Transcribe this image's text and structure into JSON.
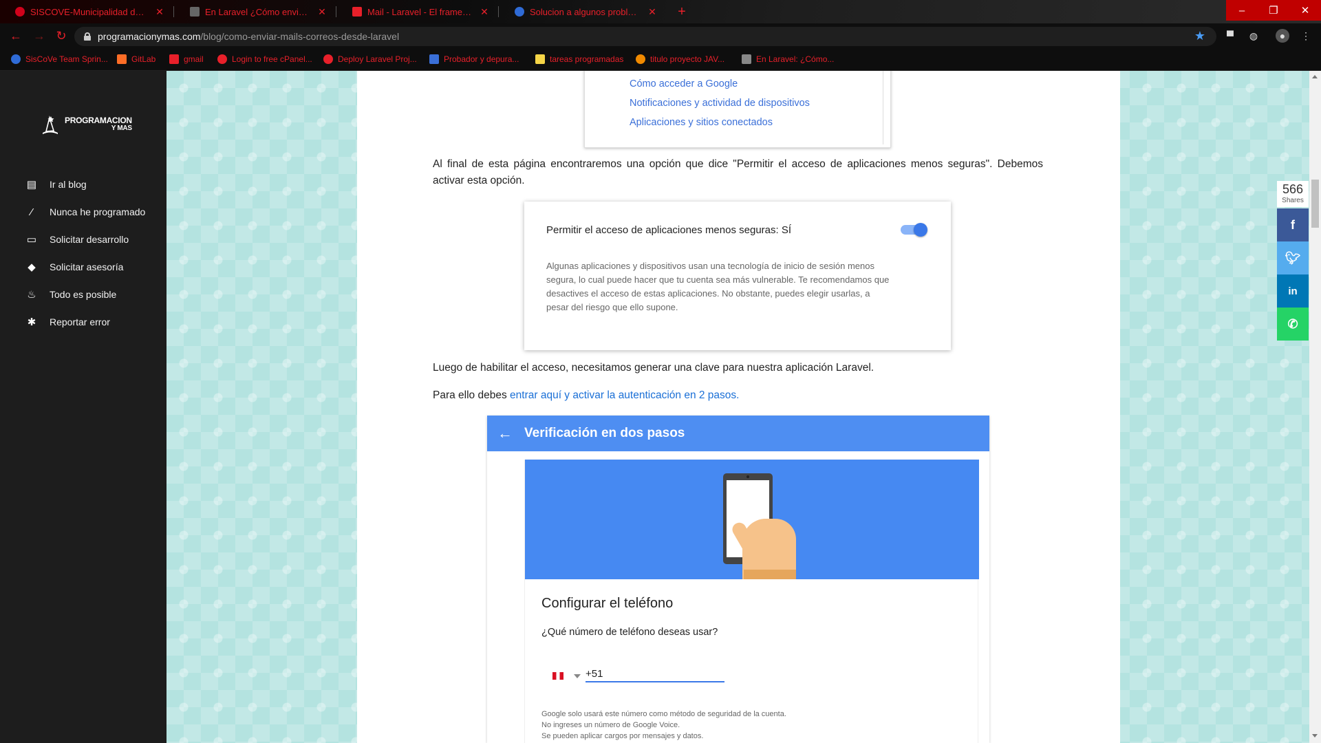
{
  "browser": {
    "tabs": [
      {
        "title": "SISCOVE-Municipalidad de Nicolás",
        "favicon_color": "#d0021b"
      },
      {
        "title": "En Laravel ¿Cómo enviar correos",
        "favicon_color": "#666666"
      },
      {
        "title": "Mail - Laravel - El framework PHP",
        "favicon_color": "#e8202a"
      },
      {
        "title": "Solucion a algunos problemas resueltos",
        "favicon_color": "#2f6bd6"
      }
    ],
    "new_tab": "+",
    "url_host": "programacionymas.com",
    "url_path": "/blog/como-enviar-mails-correos-desde-laravel",
    "bookmarks": [
      {
        "label": "SisCoVe Team Sprin...",
        "icon_color": "#2f6bd6"
      },
      {
        "label": "GitLab",
        "icon_color": "#fc6d26"
      },
      {
        "label": "gmail",
        "icon_color": "#e8202a"
      },
      {
        "label": "Login to free cPanel...",
        "icon_color": "#e8202a"
      },
      {
        "label": "Deploy Laravel Proj...",
        "icon_color": "#e8202a"
      },
      {
        "label": "Probador y depura...",
        "icon_color": "#3a6fd8"
      },
      {
        "label": "tareas programadas",
        "icon_color": "#f5d547"
      },
      {
        "label": "titulo proyecto JAV...",
        "icon_color": "#f08a00"
      },
      {
        "label": "En Laravel: ¿Cómo...",
        "icon_color": "#888888"
      }
    ]
  },
  "sidebar": {
    "brand_line1": "PROGRAMACION",
    "brand_line2": "Y MAS",
    "items": [
      {
        "label": "Ir al blog",
        "icon": "book-icon"
      },
      {
        "label": "Nunca he programado",
        "icon": "magic-wand-icon"
      },
      {
        "label": "Solicitar desarrollo",
        "icon": "laptop-icon"
      },
      {
        "label": "Solicitar asesoría",
        "icon": "graduation-cap-icon"
      },
      {
        "label": "Todo es posible",
        "icon": "fire-icon"
      },
      {
        "label": "Reportar error",
        "icon": "bug-icon"
      }
    ]
  },
  "article": {
    "list_links": [
      "Cómo acceder a Google",
      "Notificaciones y actividad de dispositivos",
      "Aplicaciones y sitios conectados"
    ],
    "para1": "Al final de esta página encontraremos una opción que dice \"Permitir el acceso de aplicaciones menos seguras\". Debemos activar esta opción.",
    "toggle_card": {
      "title": "Permitir el acceso de aplicaciones menos seguras: SÍ",
      "description": "Algunas aplicaciones y dispositivos usan una tecnología de inicio de sesión menos segura, lo cual puede hacer que tu cuenta sea más vulnerable. Te recomendamos que desactives el acceso de estas aplicaciones. No obstante, puedes elegir usarlas, a pesar del riesgo que ello supone.",
      "enabled": true
    },
    "para2": "Luego de habilitar el acceso, necesitamos generar una clave para nuestra aplicación Laravel.",
    "para3_prefix": "Para ello debes ",
    "para3_link": "entrar aquí y activar la autenticación en 2 pasos.",
    "verification": {
      "header": "Verificación en dos pasos",
      "subtitle": "Configurar el teléfono",
      "question": "¿Qué número de teléfono deseas usar?",
      "phone_value": "+51",
      "note_line1": "Google solo usará este número como método de seguridad de la cuenta.",
      "note_line2": "No ingreses un número de Google Voice.",
      "note_line3": "Se pueden aplicar cargos por mensajes y datos."
    }
  },
  "share": {
    "count": "566",
    "label": "Shares",
    "buttons": [
      {
        "icon": "facebook-icon",
        "color": "#3b5998"
      },
      {
        "icon": "twitter-icon",
        "color": "#55acee"
      },
      {
        "icon": "linkedin-icon",
        "color": "#0077b5"
      },
      {
        "icon": "whatsapp-icon",
        "color": "#25d366"
      }
    ]
  }
}
